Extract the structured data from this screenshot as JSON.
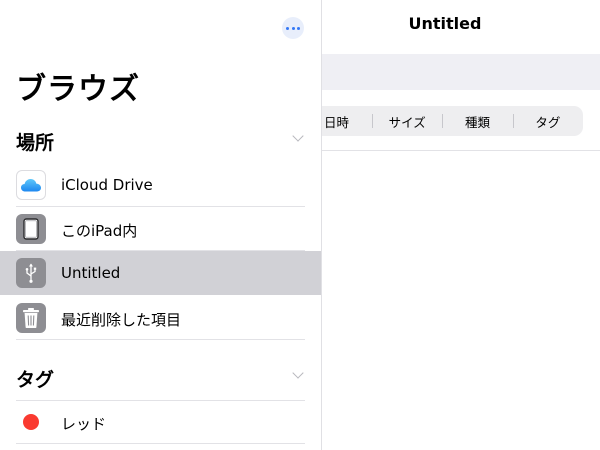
{
  "main": {
    "title": "Untitled",
    "sort": {
      "items": [
        "日時",
        "サイズ",
        "種類",
        "タグ"
      ]
    }
  },
  "sidebar": {
    "title": "ブラウズ",
    "locations": {
      "heading": "場所",
      "items": [
        {
          "label": "iCloud Drive",
          "icon": "icloud-icon"
        },
        {
          "label": "このiPad内",
          "icon": "ipad-icon"
        },
        {
          "label": "Untitled",
          "icon": "usb-icon",
          "selected": true
        },
        {
          "label": "最近削除した項目",
          "icon": "trash-icon"
        }
      ]
    },
    "tags": {
      "heading": "タグ",
      "items": [
        {
          "label": "レッド",
          "color": "#fa3a30"
        }
      ]
    }
  },
  "colors": {
    "accent": "#3478f6",
    "selected_row": "#d1d1d6",
    "tag_red": "#fa3a30"
  }
}
